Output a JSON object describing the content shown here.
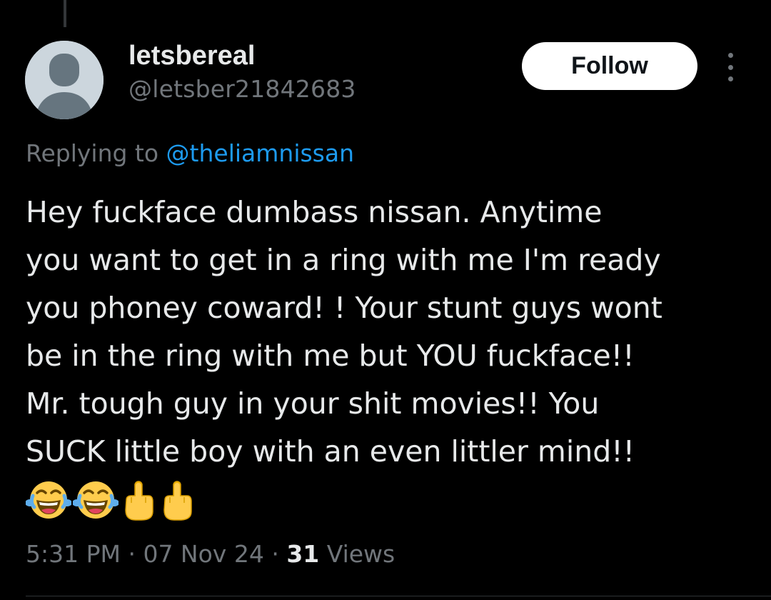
{
  "author": {
    "display_name": "letsbereal",
    "handle": "@letsber21842683"
  },
  "actions": {
    "follow_label": "Follow",
    "more_icon": "more-vertical-icon"
  },
  "reply_context": {
    "prefix": "Replying to ",
    "mention": "@theliamnissan"
  },
  "tweet": {
    "text": "Hey fuckface dumbass nissan. Anytime\nyou want to get in a ring with me I'm ready\nyou phoney coward! ! Your stunt guys wont\nbe in the ring with me but YOU fuckface!!\nMr. tough guy in your shit movies!! You\nSUCK little boy with an even littler mind!!",
    "emojis": [
      "😂",
      "😂",
      "🖕",
      "🖕"
    ]
  },
  "meta": {
    "time": "5:31 PM",
    "sep1": " · ",
    "date": "07 Nov 24",
    "sep2": " · ",
    "views_count": "31",
    "views_label": " Views"
  },
  "colors": {
    "background": "#000000",
    "text_primary": "#e7e9ea",
    "text_secondary": "#71767b",
    "link": "#1d9bf0",
    "follow_button_bg": "#ffffff"
  }
}
